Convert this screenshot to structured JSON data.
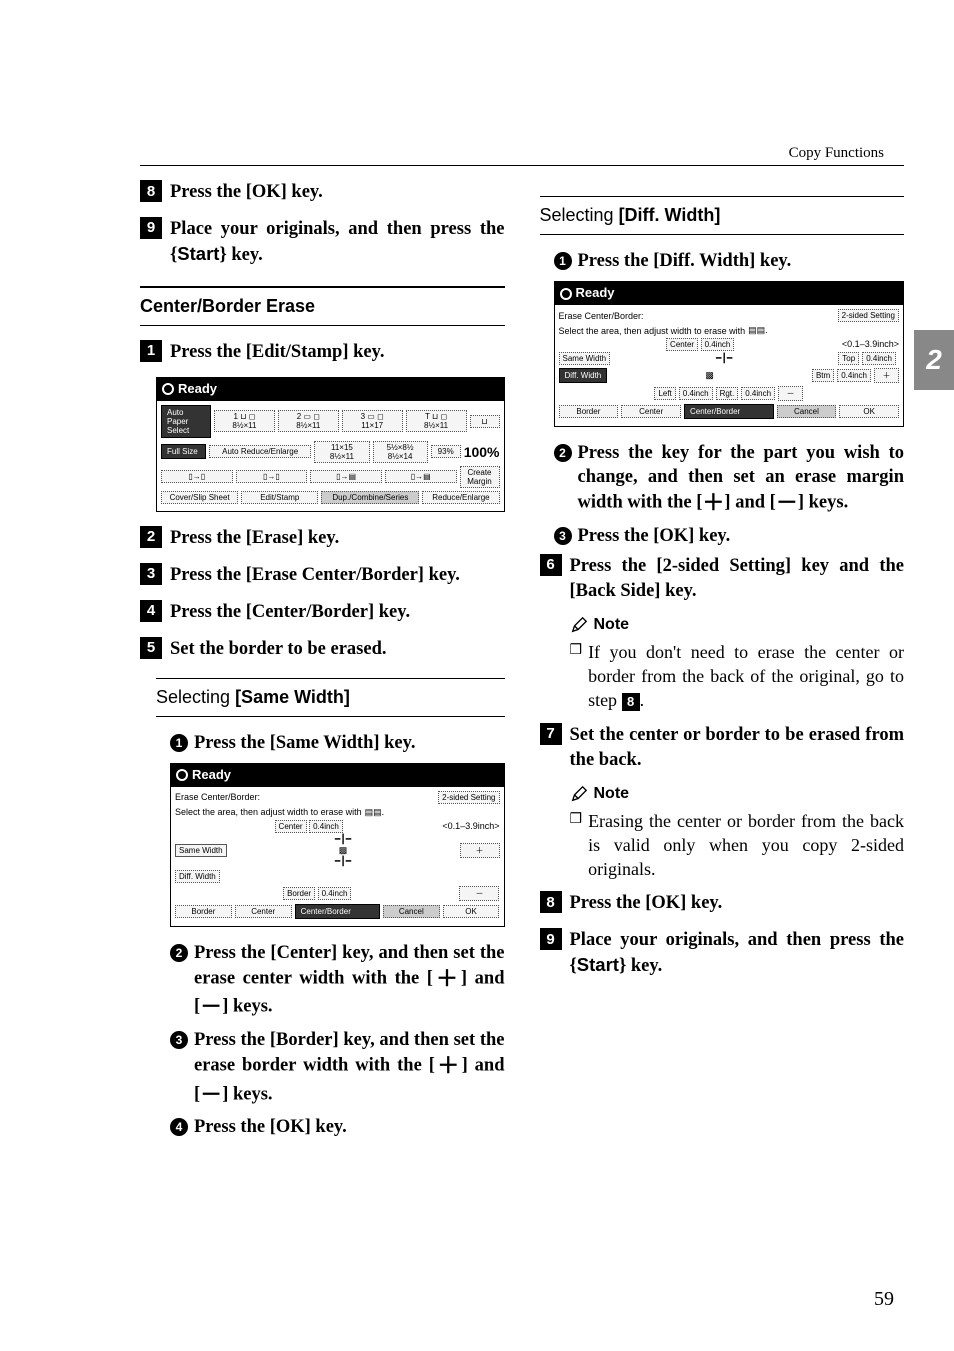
{
  "header": {
    "breadcrumb": "Copy Functions"
  },
  "tab": "2",
  "left": {
    "s8": "Press the [OK] key.",
    "s9_a": "Place your originals, and then press the ",
    "s9_key": "Start",
    "s9_b": " key.",
    "heading_cb": "Center/Border Erase",
    "s1": "Press the [Edit/Stamp] key.",
    "s2": "Press the [Erase] key.",
    "s3": "Press the [Erase Center/Border] key.",
    "s4": "Press the [Center/Border] key.",
    "s5": "Set the border to be erased.",
    "sub_same": "Selecting [Same Width]",
    "ss1": "Press the [Same Width] key.",
    "ss2_a": "Press the [Center] key, and then set the erase center width with the [",
    "ss2_b": "] and [",
    "ss2_c": "] keys.",
    "ss3_a": "Press the [Border] key, and then set the erase border width with the [",
    "ss3_b": "] and [",
    "ss3_c": "] keys.",
    "ss4": "Press the [OK] key."
  },
  "right": {
    "sub_diff": "Selecting [Diff. Width]",
    "ss1": "Press the [Diff. Width] key.",
    "ss2_a": "Press the key for the part you wish to change, and then set an erase margin width with the [",
    "ss2_b": "] and [",
    "ss2_c": "] keys.",
    "ss3": "Press the [OK] key.",
    "s6": "Press the [2-sided Setting] key and the [Back Side] key.",
    "note1": "If you don't need to erase the center or border from the back of the original, go to step ",
    "note1_step": "8",
    "s7": "Set the center or border to be erased from the back.",
    "note2": "Erasing the center or border from the back is valid only when you copy 2-sided originals.",
    "s8": "Press the [OK] key.",
    "s9_a": "Place your originals, and then press the ",
    "s9_key": "Start",
    "s9_b": " key."
  },
  "lcd1": {
    "ready": "Ready",
    "auto_paper": "Auto Paper Select",
    "tray1": "1",
    "tray2": "2",
    "tray3": "3",
    "size1": "8½×11",
    "size2": "8½×11",
    "size3": "11×17",
    "size4": "8½×11",
    "full": "Full Size",
    "auto_red": "Auto Reduce/Enlarge",
    "ratio1": "11×15 8½×11",
    "ratio2": "5½×8½ 8½×14",
    "pct": "93%",
    "hundred": "100%",
    "create": "Create Margin",
    "cover": "Cover/Slip Sheet",
    "edit": "Edit/Stamp",
    "dup": "Dup./Combine/Series",
    "reduce": "Reduce/Enlarge"
  },
  "lcd2": {
    "ready": "Ready",
    "title": "Erase Center/Border:",
    "twosided": "2-sided Setting",
    "instr": "Select the area, then adjust width to erase with",
    "center": "Center",
    "val": "0.4inch",
    "range": "<0.1–3.9inch>",
    "same": "Same Width",
    "diff": "Diff. Width",
    "border_btn": "Border",
    "border": "Border",
    "center2": "Center",
    "cb": "Center/Border",
    "cancel": "Cancel",
    "ok": "OK"
  },
  "lcd3": {
    "ready": "Ready",
    "title": "Erase Center/Border:",
    "twosided": "2-sided Setting",
    "instr": "Select the area, then adjust width to erase with",
    "center": "Center",
    "val": "0.4inch",
    "range": "<0.1–3.9inch>",
    "same": "Same Width",
    "diff": "Diff. Width",
    "top": "Top",
    "btm": "Btm",
    "left": "Left",
    "rgt": "Rgt.",
    "border": "Border",
    "center2": "Center",
    "cb": "Center/Border",
    "cancel": "Cancel",
    "ok": "OK"
  },
  "note_label": "Note",
  "page": "59"
}
